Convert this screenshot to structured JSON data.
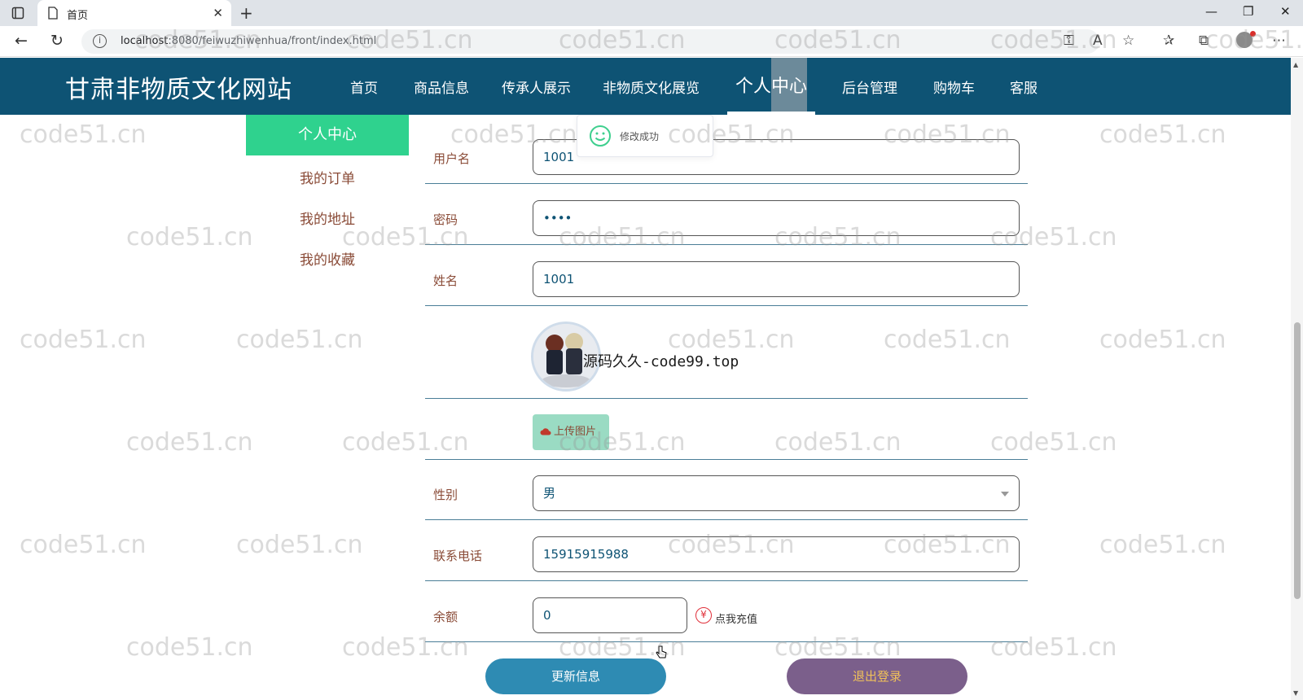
{
  "browser": {
    "tab_title": "首页",
    "url_host": "localhost",
    "url_rest": ":8080/feiwuzhiwenhua/front/index.html"
  },
  "site": {
    "title": "甘肃非物质文化网站",
    "nav": [
      {
        "label": "首页"
      },
      {
        "label": "商品信息"
      },
      {
        "label": "传承人展示"
      },
      {
        "label": "非物质文化展览"
      },
      {
        "label": "个人中心",
        "active": true
      },
      {
        "label": "后台管理"
      },
      {
        "label": "购物车"
      },
      {
        "label": "客服"
      }
    ]
  },
  "sidebar": {
    "items": [
      {
        "label": "个人中心",
        "active": true
      },
      {
        "label": "我的订单"
      },
      {
        "label": "我的地址"
      },
      {
        "label": "我的收藏"
      }
    ]
  },
  "toast": {
    "message": "修改成功"
  },
  "form": {
    "username": {
      "label": "用户名",
      "value": "1001"
    },
    "password": {
      "label": "密码",
      "value": "••••"
    },
    "name": {
      "label": "姓名",
      "value": "1001"
    },
    "avatar_overlay_text": "源码久久-code99.top",
    "upload_label": "上传图片",
    "gender": {
      "label": "性别",
      "value": "男"
    },
    "phone": {
      "label": "联系电话",
      "value": "15915915988"
    },
    "balance": {
      "label": "余额",
      "value": "0"
    },
    "recharge_label": "点我充值",
    "update_button": "更新信息",
    "logout_button": "退出登录"
  },
  "watermark": "code51.cn",
  "colors": {
    "header_bg": "#0e5374",
    "sidebar_active": "#2fd28e",
    "label_color": "#8a4b37",
    "update_btn": "#2e8bb3",
    "logout_btn": "#7b5f8b"
  }
}
